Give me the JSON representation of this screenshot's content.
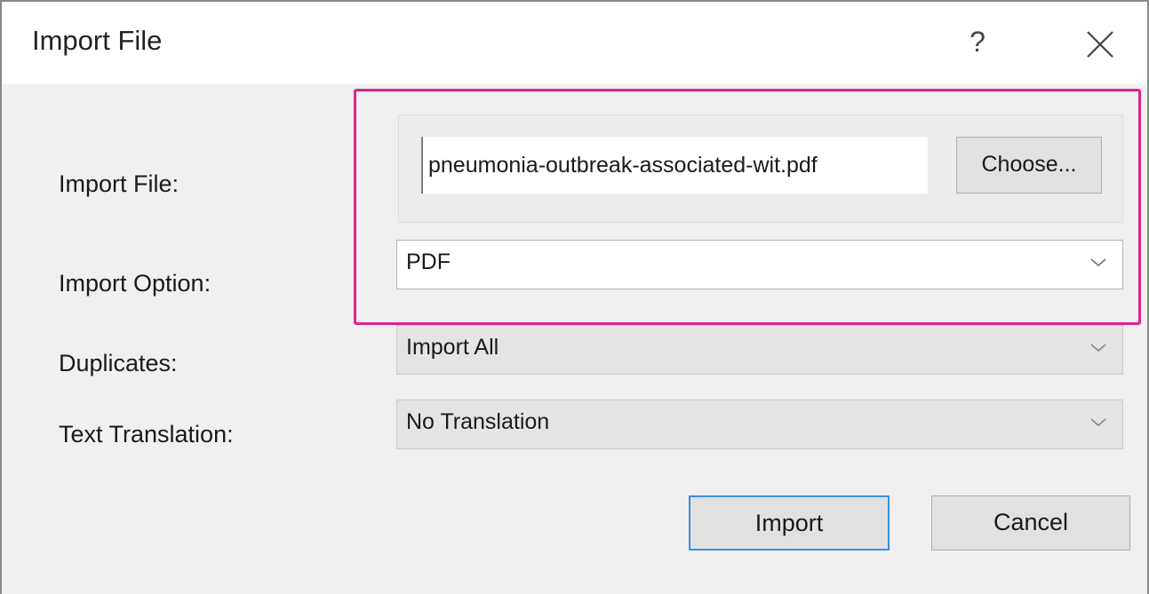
{
  "dialog": {
    "title": "Import File",
    "help_label": "?"
  },
  "form": {
    "import_file": {
      "label": "Import File:",
      "value": "pneumonia-outbreak-associated-wit.pdf",
      "choose_label": "Choose..."
    },
    "import_option": {
      "label": "Import Option:",
      "value": "PDF"
    },
    "duplicates": {
      "label": "Duplicates:",
      "value": "Import All"
    },
    "text_translation": {
      "label": "Text Translation:",
      "value": "No Translation"
    }
  },
  "buttons": {
    "import_label": "Import",
    "cancel_label": "Cancel"
  },
  "colors": {
    "highlight": "#e0218a",
    "default_button_border": "#3a8ee0"
  },
  "icons": {
    "close": "close-icon",
    "dropdown": "chevron-down-icon"
  }
}
